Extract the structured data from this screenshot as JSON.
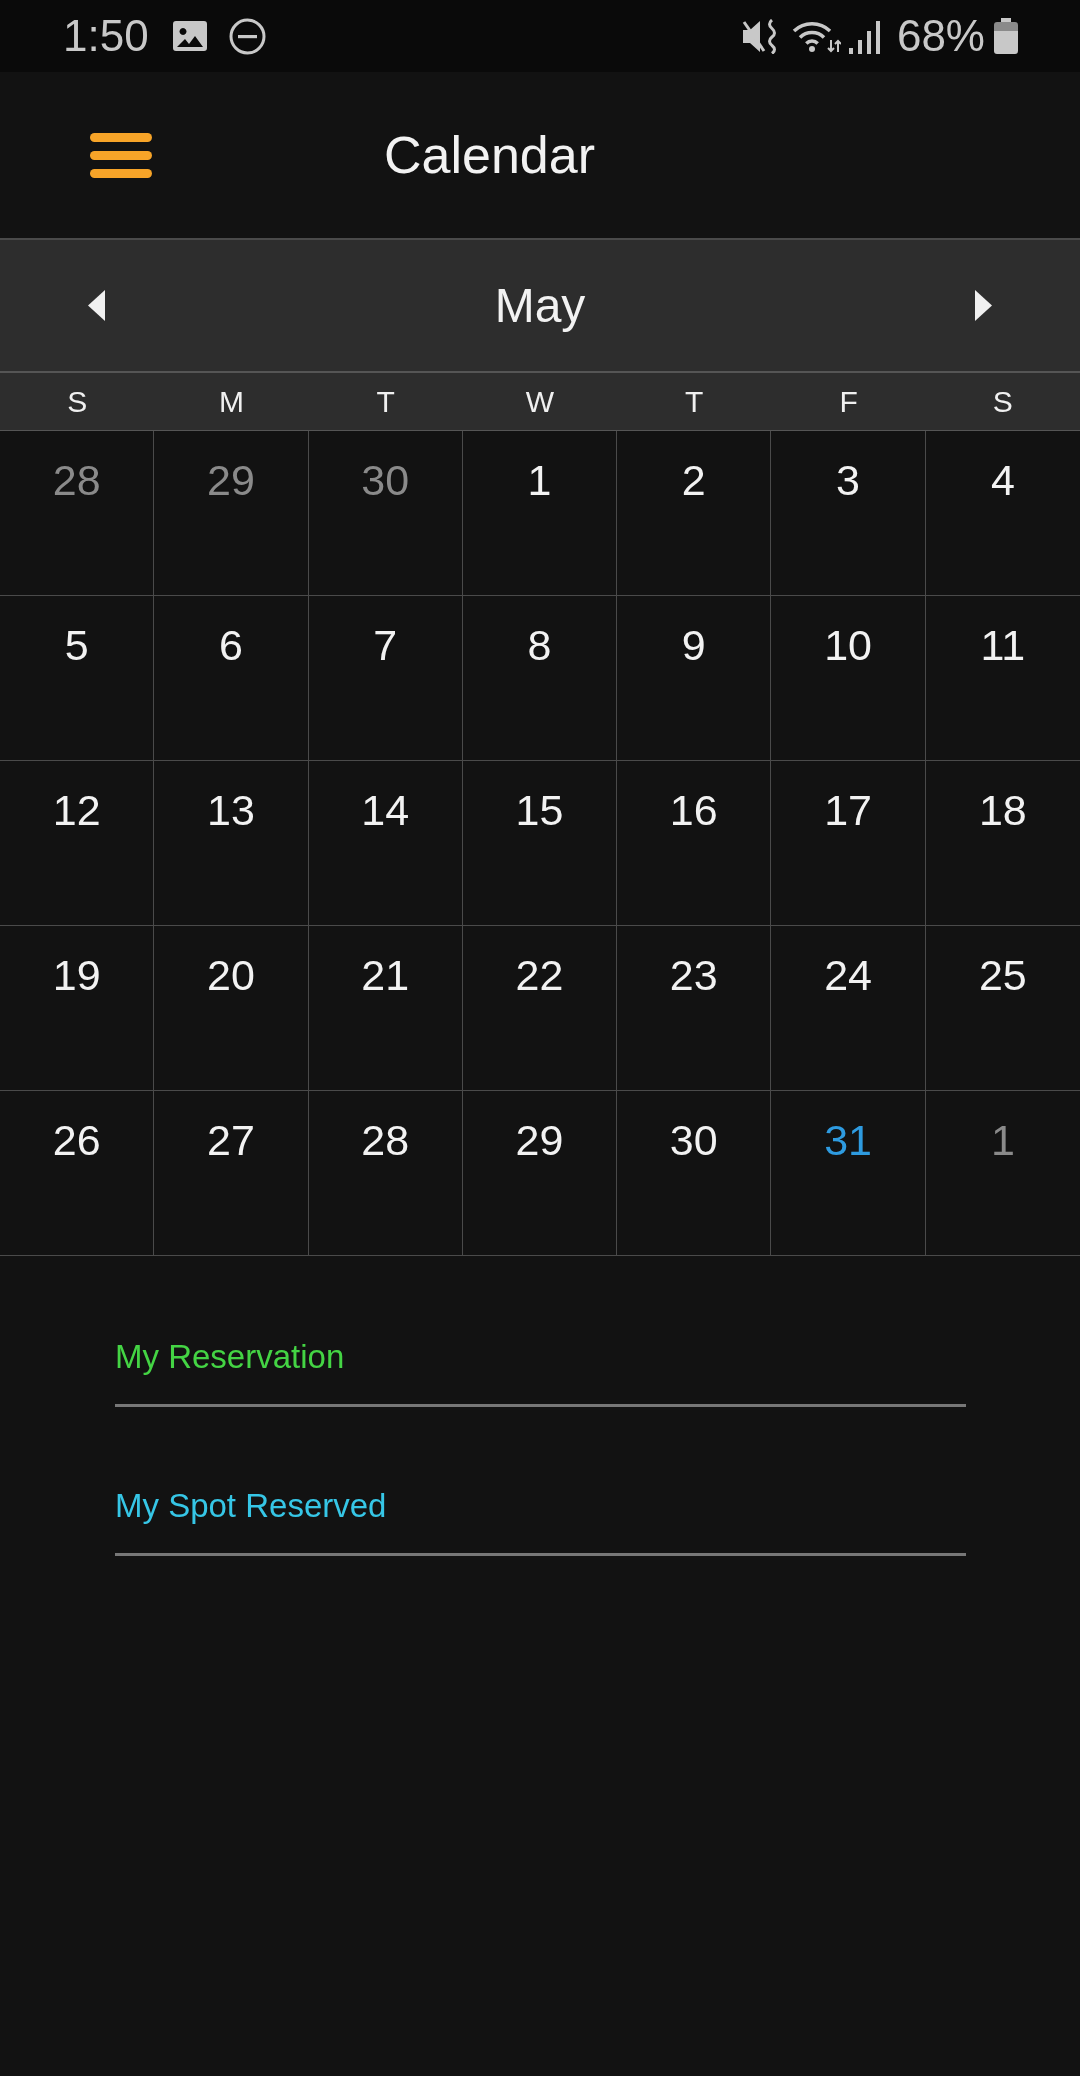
{
  "status_bar": {
    "time": "1:50",
    "battery": "68%"
  },
  "app_bar": {
    "title": "Calendar"
  },
  "month_nav": {
    "month": "May"
  },
  "weekdays": [
    "S",
    "M",
    "T",
    "W",
    "T",
    "F",
    "S"
  ],
  "weeks": [
    {
      "days": [
        {
          "label": "28",
          "in_month": false,
          "today": false
        },
        {
          "label": "29",
          "in_month": false,
          "today": false
        },
        {
          "label": "30",
          "in_month": false,
          "today": false
        },
        {
          "label": "1",
          "in_month": true,
          "today": false
        },
        {
          "label": "2",
          "in_month": true,
          "today": false
        },
        {
          "label": "3",
          "in_month": true,
          "today": false
        },
        {
          "label": "4",
          "in_month": true,
          "today": false
        }
      ]
    },
    {
      "days": [
        {
          "label": "5",
          "in_month": true,
          "today": false
        },
        {
          "label": "6",
          "in_month": true,
          "today": false
        },
        {
          "label": "7",
          "in_month": true,
          "today": false
        },
        {
          "label": "8",
          "in_month": true,
          "today": false
        },
        {
          "label": "9",
          "in_month": true,
          "today": false
        },
        {
          "label": "10",
          "in_month": true,
          "today": false
        },
        {
          "label": "11",
          "in_month": true,
          "today": false
        }
      ]
    },
    {
      "days": [
        {
          "label": "12",
          "in_month": true,
          "today": false
        },
        {
          "label": "13",
          "in_month": true,
          "today": false
        },
        {
          "label": "14",
          "in_month": true,
          "today": false
        },
        {
          "label": "15",
          "in_month": true,
          "today": false
        },
        {
          "label": "16",
          "in_month": true,
          "today": false
        },
        {
          "label": "17",
          "in_month": true,
          "today": false
        },
        {
          "label": "18",
          "in_month": true,
          "today": false
        }
      ]
    },
    {
      "days": [
        {
          "label": "19",
          "in_month": true,
          "today": false
        },
        {
          "label": "20",
          "in_month": true,
          "today": false
        },
        {
          "label": "21",
          "in_month": true,
          "today": false
        },
        {
          "label": "22",
          "in_month": true,
          "today": false
        },
        {
          "label": "23",
          "in_month": true,
          "today": false
        },
        {
          "label": "24",
          "in_month": true,
          "today": false
        },
        {
          "label": "25",
          "in_month": true,
          "today": false
        }
      ]
    },
    {
      "days": [
        {
          "label": "26",
          "in_month": true,
          "today": false
        },
        {
          "label": "27",
          "in_month": true,
          "today": false
        },
        {
          "label": "28",
          "in_month": true,
          "today": false
        },
        {
          "label": "29",
          "in_month": true,
          "today": false
        },
        {
          "label": "30",
          "in_month": true,
          "today": false
        },
        {
          "label": "31",
          "in_month": true,
          "today": true
        },
        {
          "label": "1",
          "in_month": false,
          "today": false
        }
      ]
    }
  ],
  "legend": [
    {
      "label": "My Reservation",
      "color": "#44d444"
    },
    {
      "label": "My Spot Reserved",
      "color": "#36c6e6"
    }
  ]
}
